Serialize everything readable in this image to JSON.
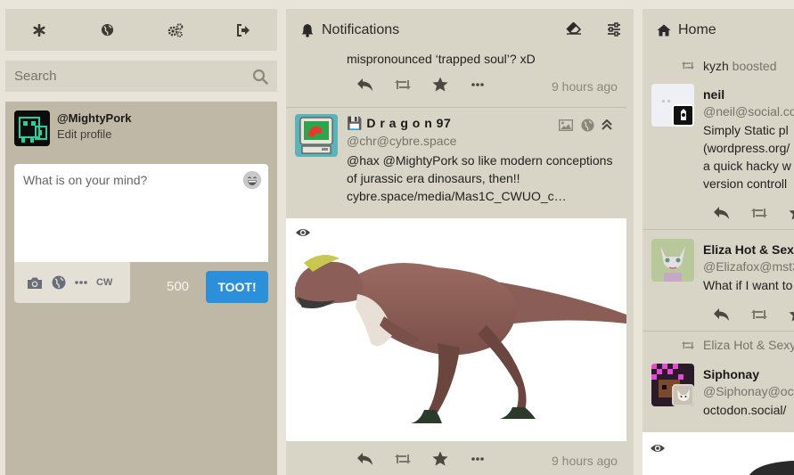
{
  "nav": {
    "getting_started": "getting-started-icon",
    "public": "globe-icon",
    "preferences": "cogs-icon",
    "logout": "sign-out-icon"
  },
  "search": {
    "placeholder": "Search"
  },
  "compose": {
    "handle": "@MightyPork",
    "edit_profile": "Edit profile",
    "placeholder": "What is on your mind?",
    "cw": "CW",
    "char_count": "500",
    "toot": "TOOT!"
  },
  "notifications": {
    "title": "Notifications",
    "prev_status": {
      "text": "mispronounced ‘trapped soul’? xD",
      "time": "9 hours ago"
    },
    "status": {
      "display_name": "💾 D r a g o n 97",
      "acct": "@chr@cybre.space",
      "text_mention": "@hax @MightyPork",
      "text_body": " so like modern conceptions of jurassic era dinosaurs, then!!",
      "link": "cybre.space/media/Mas1C_CWUO_c…",
      "time": "9 hours ago"
    }
  },
  "home": {
    "title": "Home",
    "boost1": {
      "who": "kyzh",
      "label": " boosted"
    },
    "neil": {
      "display_name": "neil",
      "acct": "@neil@social.co",
      "lines": [
        "Simply Static pl",
        "(wordpress.org/",
        "a quick hacky w",
        "version controll"
      ]
    },
    "eliza": {
      "display_name": "Eliza Hot & Sex",
      "acct": "@Elizafox@mst3",
      "text": "What if I want to"
    },
    "boost2": {
      "label": "Eliza Hot & Sexy"
    },
    "siphonay": {
      "display_name": "Siphonay",
      "acct": "@Siphonay@oct",
      "text": "octodon.social/"
    }
  },
  "colors": {
    "background": "#e8e4da",
    "panel": "#d8d4c6",
    "compose": "#c0b8a6",
    "accent": "#2b90d9"
  }
}
